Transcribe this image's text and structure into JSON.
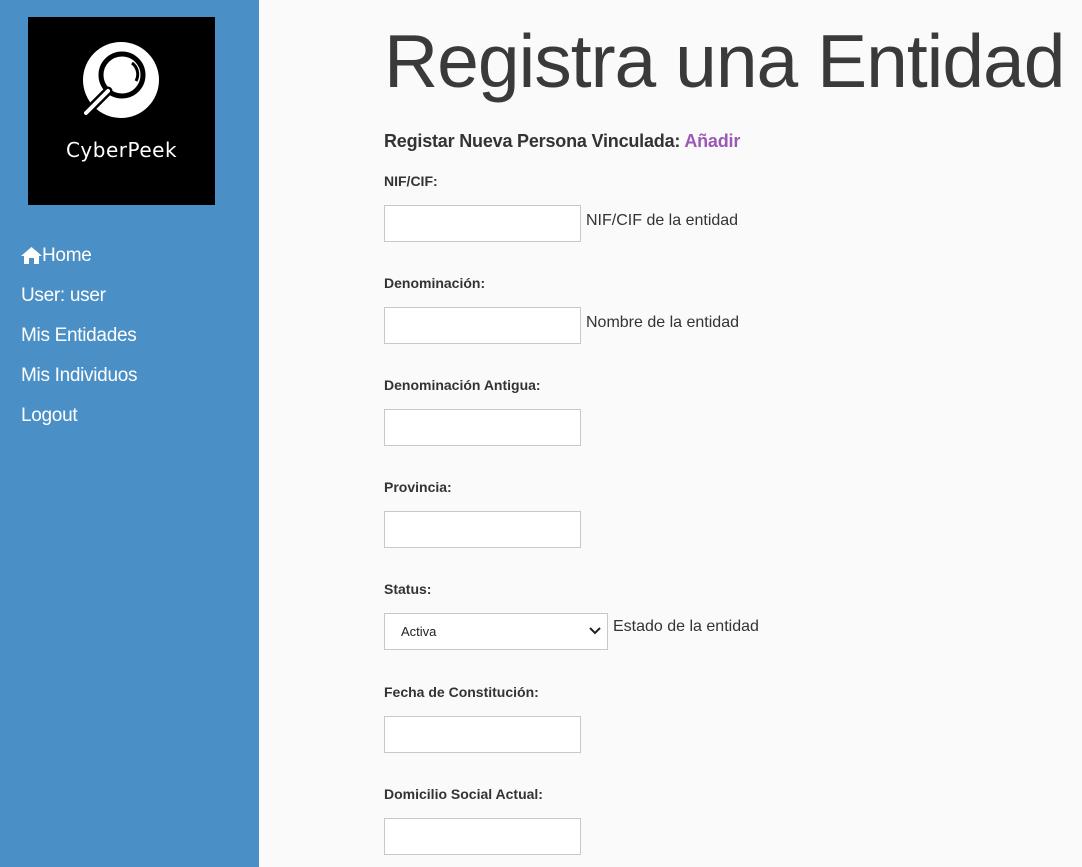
{
  "brand": {
    "name": "CyberPeek"
  },
  "nav": [
    {
      "label": "Home",
      "icon": "home-icon"
    },
    {
      "label": "User: user"
    },
    {
      "label": "Mis Entidades"
    },
    {
      "label": "Mis Individuos"
    },
    {
      "label": "Logout"
    }
  ],
  "page": {
    "title": "Registra una Entidad",
    "subheading": "Registar Nueva Persona Vinculada:",
    "subheading_link": "Añadir"
  },
  "form": {
    "nif": {
      "label": "NIF/CIF:",
      "value": "",
      "help": "NIF/CIF de la entidad"
    },
    "denominacion": {
      "label": "Denominación:",
      "value": "",
      "help": "Nombre de la entidad"
    },
    "denominacion_antigua": {
      "label": "Denominación Antigua:",
      "value": ""
    },
    "provincia": {
      "label": "Provincia:",
      "value": ""
    },
    "status": {
      "label": "Status:",
      "selected": "Activa",
      "help": "Estado de la entidad"
    },
    "fecha_constitucion": {
      "label": "Fecha de Constitución:",
      "value": ""
    },
    "domicilio": {
      "label": "Domicilio Social Actual:",
      "value": ""
    }
  },
  "colors": {
    "sidebar": "#4a90c6",
    "accent_link": "#9b59b6",
    "background": "#fafafa"
  }
}
